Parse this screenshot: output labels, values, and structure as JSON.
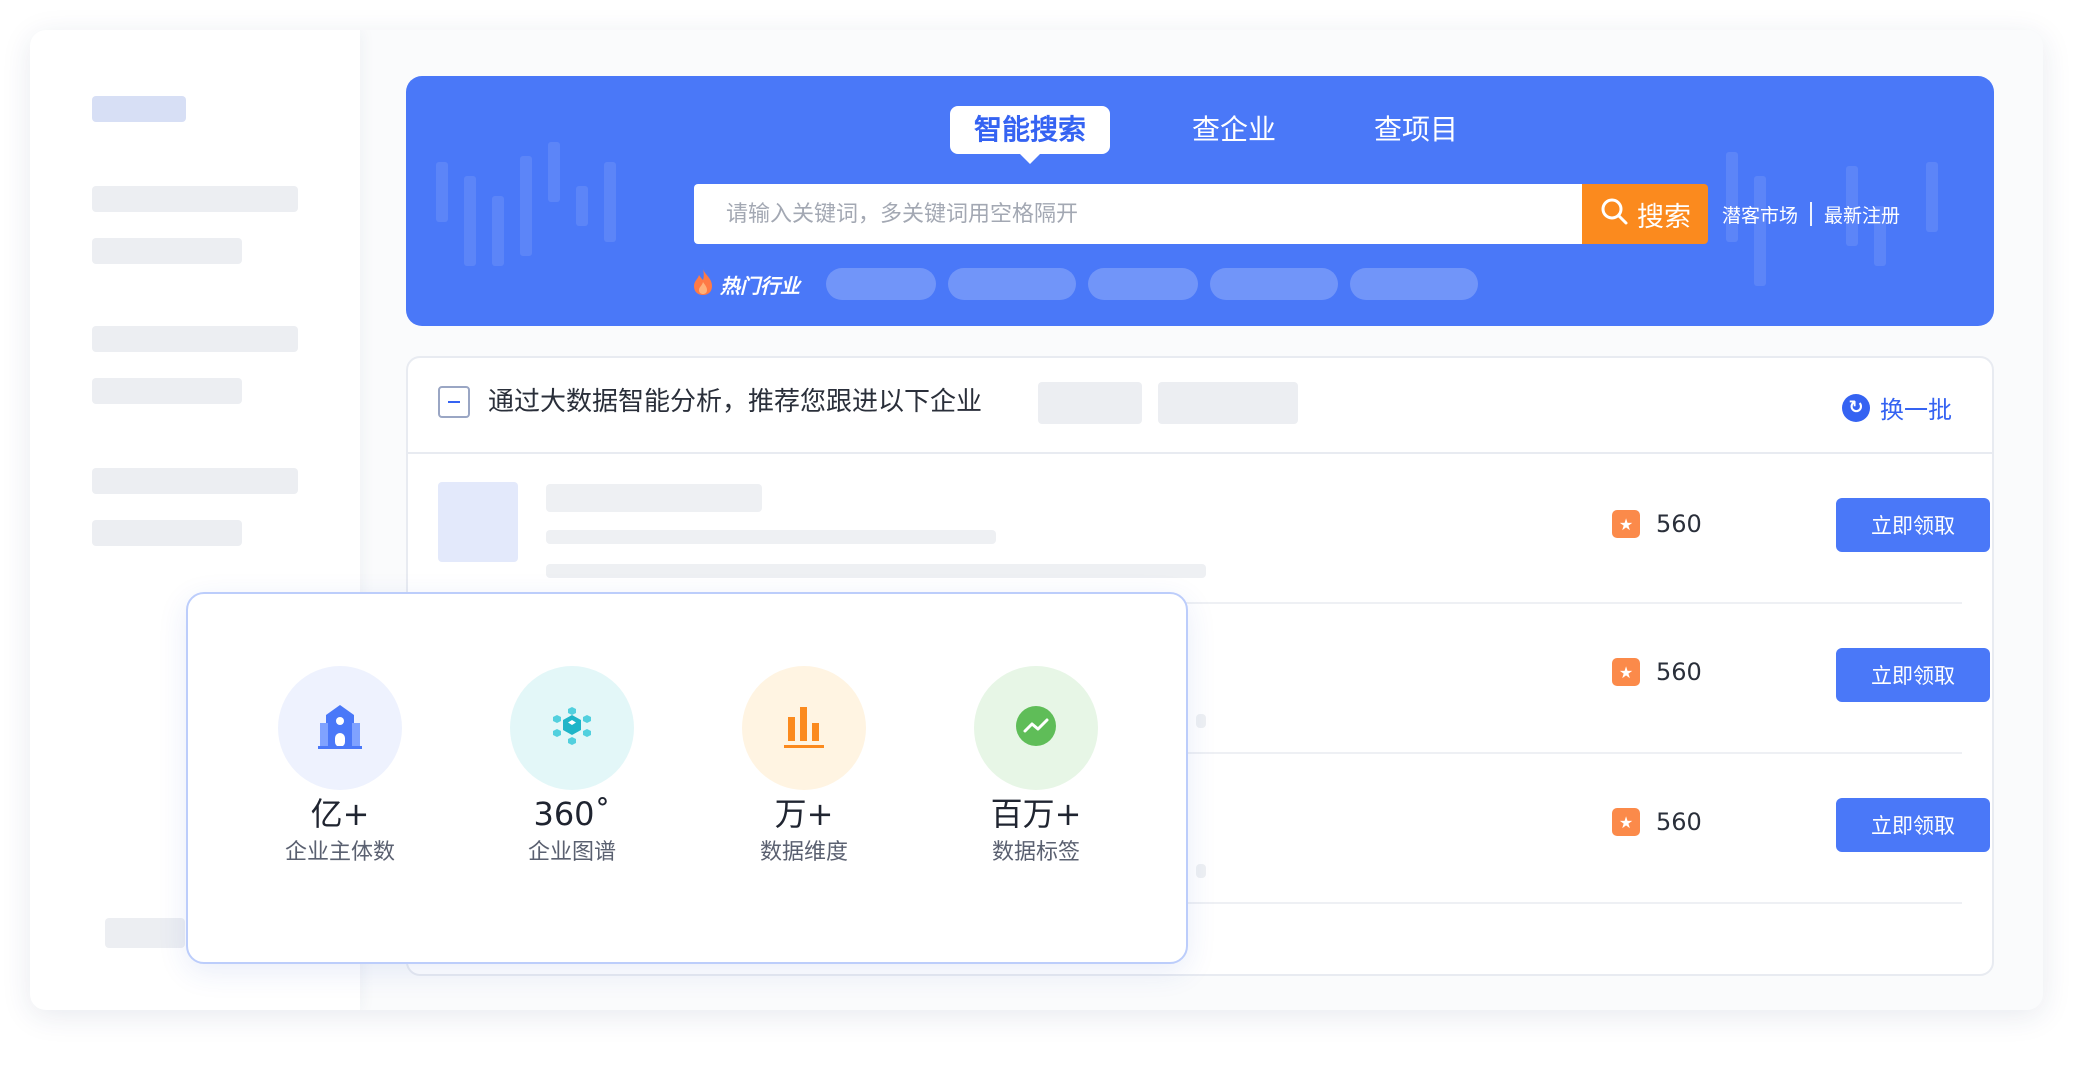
{
  "hero": {
    "tabs": [
      {
        "label": "智能搜索",
        "active": true
      },
      {
        "label": "查企业",
        "active": false
      },
      {
        "label": "查项目",
        "active": false
      }
    ],
    "search": {
      "placeholder": "请输入关键词，多关键词用空格隔开",
      "button_label": "搜索"
    },
    "quick_links": [
      "潜客市场",
      "最新注册"
    ],
    "hot_label": "热门行业",
    "colors": {
      "banner": "#4a78f8",
      "search_button": "#fb8a1e"
    }
  },
  "recommend": {
    "title": "通过大数据智能分析，推荐您跟进以下企业",
    "refresh_label": "换一批",
    "rows": [
      {
        "score": "560",
        "action_label": "立即领取"
      },
      {
        "score": "560",
        "action_label": "立即领取"
      },
      {
        "score": "560",
        "action_label": "立即领取"
      }
    ]
  },
  "stats": [
    {
      "value": "亿+",
      "label": "企业主体数",
      "icon": "building-icon",
      "bg": "#eef2fe"
    },
    {
      "value": "360˚",
      "label": "企业图谱",
      "icon": "graph-cube-icon",
      "bg": "#e3f7f8"
    },
    {
      "value": "万+",
      "label": "数据维度",
      "icon": "bar-chart-icon",
      "bg": "#fff4e2"
    },
    {
      "value": "百万+",
      "label": "数据标签",
      "icon": "trend-icon",
      "bg": "#e7f6e6"
    }
  ]
}
